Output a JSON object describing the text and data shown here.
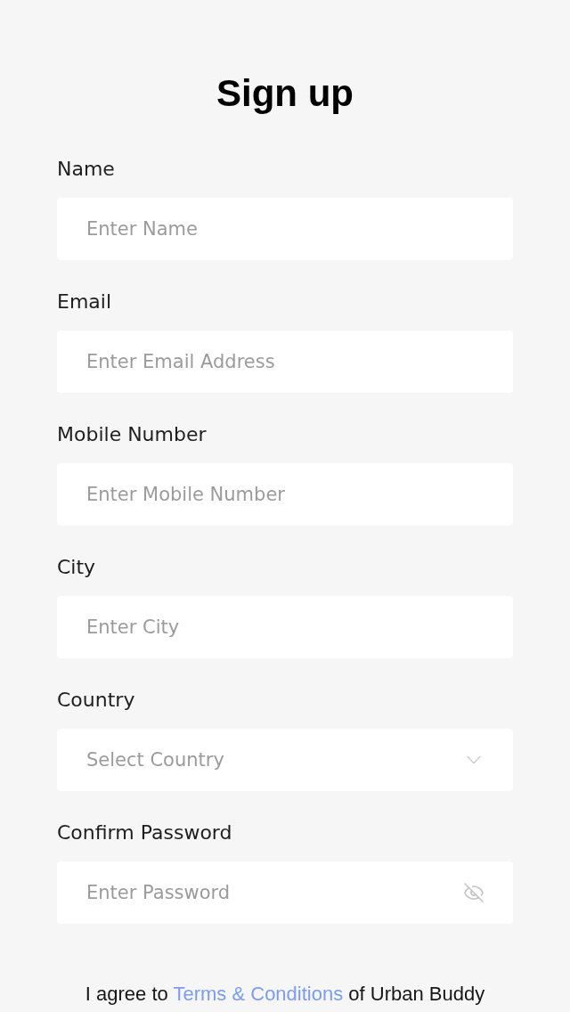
{
  "title": "Sign up",
  "fields": [
    {
      "label": "Name",
      "placeholder": "Enter Name",
      "kind": "text"
    },
    {
      "label": "Email",
      "placeholder": "Enter Email Address",
      "kind": "text"
    },
    {
      "label": "Mobile Number",
      "placeholder": "Enter Mobile Number",
      "kind": "text"
    },
    {
      "label": "City",
      "placeholder": "Enter City",
      "kind": "text"
    },
    {
      "label": "Country",
      "placeholder": "Select Country",
      "kind": "select"
    },
    {
      "label": "Confirm Password",
      "placeholder": "Enter Password",
      "kind": "password"
    }
  ],
  "agreement": {
    "text_before": "I agree to",
    "link": "Terms & Conditions",
    "text_after": "of Urban Buddy"
  }
}
